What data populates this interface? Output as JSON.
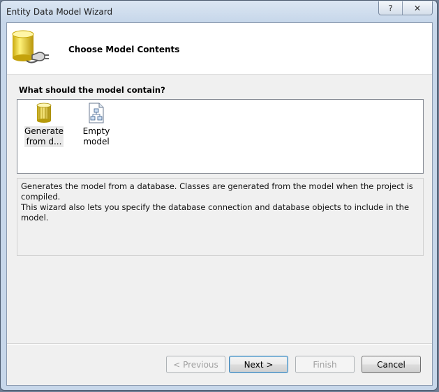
{
  "window": {
    "title": "Entity Data Model Wizard",
    "help_glyph": "?",
    "close_glyph": "✕"
  },
  "header": {
    "title": "Choose Model Contents",
    "icon": "database-plug-icon"
  },
  "question": "What should the model contain?",
  "model_options": [
    {
      "label_line1": "Generate",
      "label_line2": "from d...",
      "icon": "database-icon",
      "selected": true
    },
    {
      "label_line1": "Empty model",
      "label_line2": "",
      "icon": "empty-model-icon",
      "selected": false
    }
  ],
  "description": {
    "line1": "Generates the model from a database. Classes are generated from the model when the project is compiled.",
    "line2": "This wizard also lets you specify the database connection and database objects to include in the model."
  },
  "buttons": {
    "previous": "< Previous",
    "next": "Next >",
    "finish": "Finish",
    "cancel": "Cancel"
  }
}
